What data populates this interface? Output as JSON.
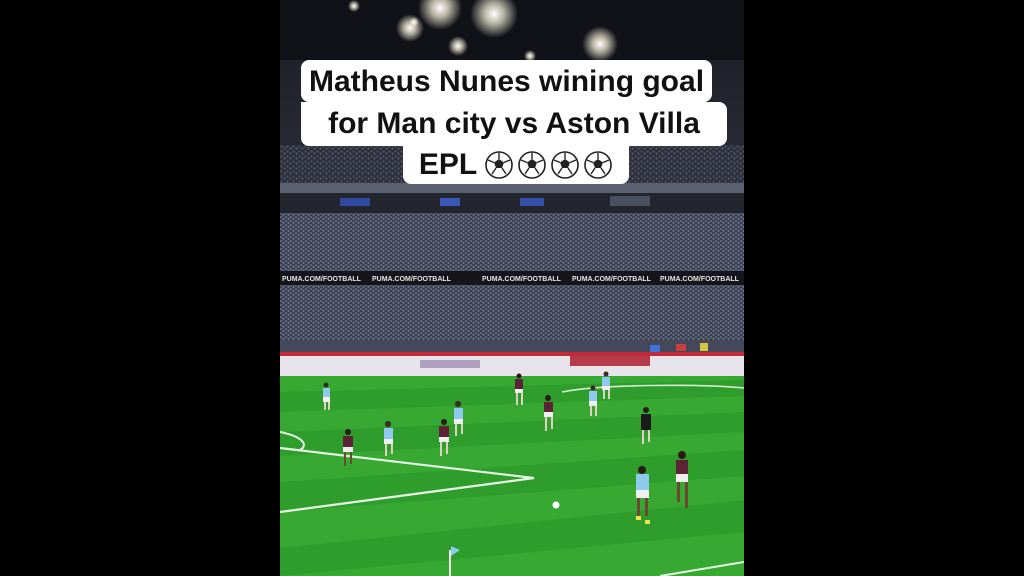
{
  "caption": {
    "line1": "Matheus Nunes wining goal",
    "line2": "for Man city vs Aston Villa",
    "line3_text": "EPL",
    "emoji_icons": [
      "soccer-ball-icon",
      "soccer-ball-icon",
      "soccer-ball-icon",
      "soccer-ball-icon"
    ]
  },
  "stadium": {
    "ad_board_text": "PUMA.COM/FOOTBALL"
  },
  "colors": {
    "pitch_light": "#37a832",
    "pitch_dark": "#2e9a2b",
    "city_kit": "#8ec9ee",
    "villa_kit": "#5b2333",
    "referee_kit": "#1a1a1a"
  }
}
